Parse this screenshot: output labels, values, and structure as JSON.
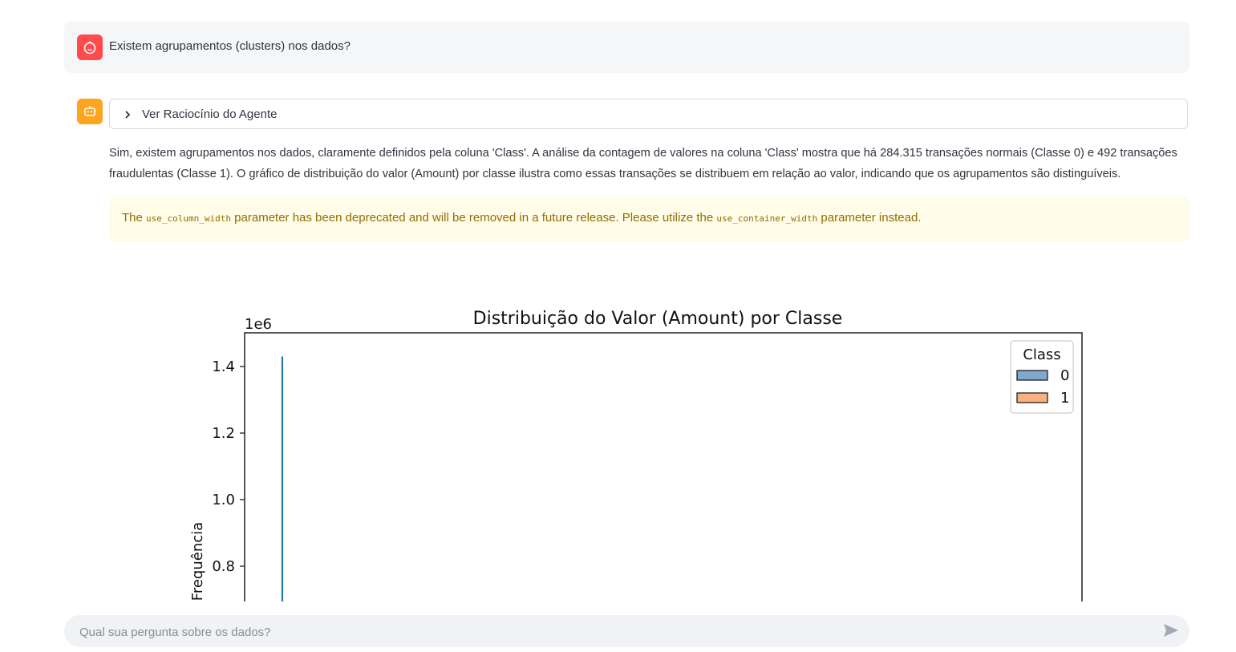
{
  "user_message": {
    "text": "Existem agrupamentos (clusters) nos dados?"
  },
  "assistant": {
    "expander_label": "Ver Raciocínio do Agente",
    "answer_text": "Sim, existem agrupamentos nos dados, claramente definidos pela coluna 'Class'. A análise da contagem de valores na coluna 'Class' mostra que há 284.315 transações normais (Classe 0) e 492 transações fraudulentas (Classe 1). O gráfico de distribuição do valor (Amount) por classe ilustra como essas transações se distribuem em relação ao valor, indicando que os agrupamentos são distinguíveis.",
    "warning": {
      "prefix": "The",
      "code1": "use_column_width",
      "middle": "parameter has been deprecated and will be removed in a future release. Please utilize the",
      "code2": "use_container_width",
      "suffix": "parameter instead."
    }
  },
  "chart_data": {
    "type": "line",
    "title": "Distribuição do Valor (Amount) por Classe",
    "ylabel": "Frequência",
    "y_offset_label": "1e6",
    "y_ticks": [
      "0.8",
      "1.0",
      "1.2",
      "1.4"
    ],
    "y_tick_values": [
      0.8,
      1.0,
      1.2,
      1.4
    ],
    "ylim": [
      0.68,
      1.5
    ],
    "legend": {
      "title": "Class",
      "entries": [
        "0",
        "1"
      ],
      "placement": "top-right"
    },
    "series": [
      {
        "name": "0",
        "color": "#1f77b4",
        "x_rel": 0.045,
        "y_top": 1.43,
        "y_bottom": 0.68
      },
      {
        "name": "1",
        "color": "#ff7f0e"
      }
    ],
    "legend_colors": [
      "#7fa9cc",
      "#f9b27e"
    ]
  },
  "chat_input": {
    "placeholder": "Qual sua pergunta sobre os dados?"
  },
  "colors": {
    "user_avatar": "#ff4b4b",
    "bot_avatar": "#ffa421",
    "warning_bg": "#fffce7",
    "warning_text": "#926c05"
  },
  "icons": {
    "user_avatar": "user-face-icon",
    "bot_avatar": "robot-icon",
    "expander": "chevron-right-icon",
    "send": "send-icon"
  }
}
